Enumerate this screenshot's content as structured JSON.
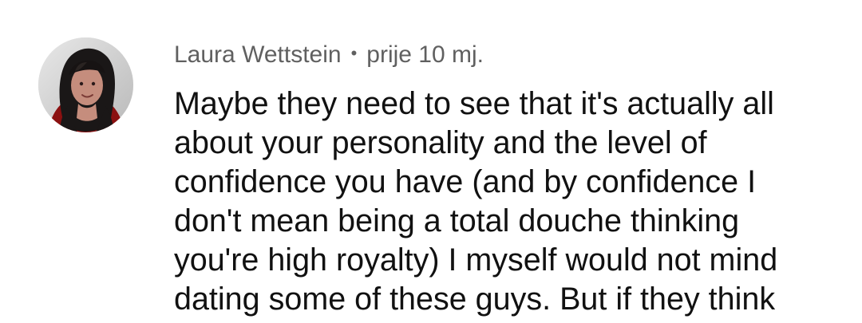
{
  "comment": {
    "author": "Laura Wettstein",
    "separator": "•",
    "timestamp": "prije 10 mj.",
    "text": "Maybe they need to see that it's actually all\nabout your personality and the level of\nconfidence you have (and by confidence I\ndon't mean being a total douche thinking\nyou're high royalty) I myself would not mind\ndating some of these guys. But if they think",
    "avatar_icon": "user-avatar-photo"
  },
  "colors": {
    "background": "#ffffff",
    "meta_text": "#606060",
    "body_text": "#111111"
  }
}
